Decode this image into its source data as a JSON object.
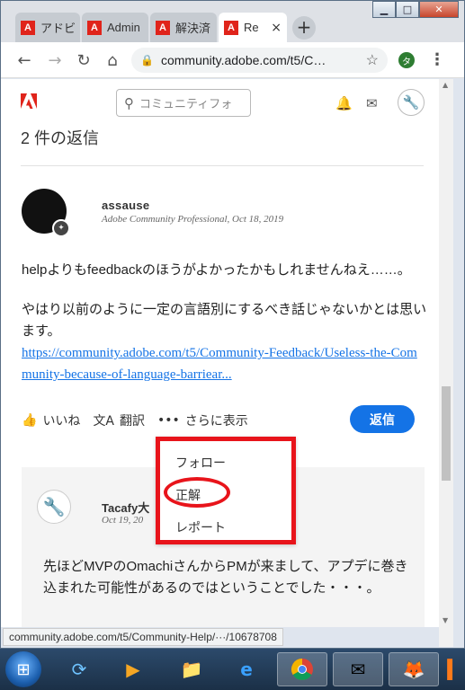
{
  "browser": {
    "tabs": [
      {
        "label": "アドビ",
        "favicon": "adobe-favicon"
      },
      {
        "label": "Admin",
        "favicon": "adobe-favicon"
      },
      {
        "label": "解決済",
        "favicon": "adobe-favicon"
      },
      {
        "label": "Re",
        "favicon": "adobe-favicon",
        "close": "×"
      }
    ],
    "new_tab": "+",
    "url": "community.adobe.com/t5/C…",
    "profile_initial": "タ"
  },
  "window_controls": {
    "minimize": "▁",
    "maximize": "□",
    "close": "✕"
  },
  "site": {
    "logo": "adobe-logo",
    "search_placeholder": "コミュニティフォ"
  },
  "thread": {
    "replies_heading": "2 件の返信",
    "post": {
      "username": "assause",
      "meta": "Adobe Community Professional, Oct 18, 2019",
      "line1": "helpよりもfeedbackのほうがよかったかもしれませんねえ……。",
      "line2": "やはり以前のように一定の言語別にするべき話じゃないかとは思います。",
      "link": "https://community.adobe.com/t5/Community-Feedback/Useless-the-Community-because-of-language-barriear..."
    },
    "actions": {
      "like": "いいね",
      "translate": "翻訳",
      "more": "さらに表示",
      "reply": "返信"
    },
    "dropdown": {
      "follow": "フォロー",
      "correct": "正解",
      "report": "レポート"
    },
    "reply": {
      "username": "Tacafy大",
      "meta": "Oct 19, 20",
      "text": "先ほどMVPのOmachiさんからPMが来まして、アプデに巻き込まれた可能性があるのではということでした・・・。"
    }
  },
  "status_url": "community.adobe.com/t5/Community-Help/···/10678708",
  "colors": {
    "accent": "#1473e6",
    "highlight": "#e8141b",
    "adobe_red": "#e0241b"
  }
}
